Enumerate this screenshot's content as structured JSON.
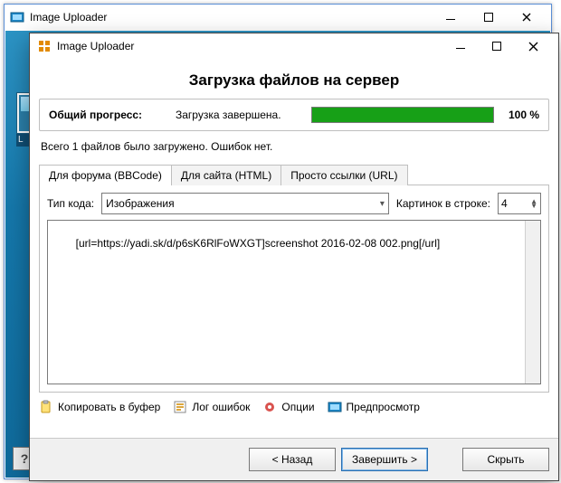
{
  "bgWindow": {
    "title": "Image Uploader",
    "thumbLetter": "L"
  },
  "dialog": {
    "title": "Image Uploader",
    "header": "Загрузка файлов на сервер",
    "progress": {
      "label": "Общий прогресс:",
      "status": "Загрузка завершена.",
      "percentText": "100 %"
    },
    "summary": "Всего 1 файлов было загружено. Ошибок нет.",
    "tabs": {
      "bbcode": "Для форума (BBCode)",
      "html": "Для сайта (HTML)",
      "url": "Просто ссылки (URL)"
    },
    "codeTypeLabel": "Тип кода:",
    "codeTypeSelected": "Изображения",
    "picsPerRowLabel": "Картинок в строке:",
    "picsPerRowValue": "4",
    "output": "[url=https://yadi.sk/d/p6sK6RlFoWXGT]screenshot 2016-02-08 002.png[/url]",
    "actions": {
      "copy": "Копировать в буфер",
      "log": "Лог ошибок",
      "options": "Опции",
      "preview": "Предпросмотр"
    },
    "buttons": {
      "back": "< Назад",
      "finish": "Завершить >",
      "hide": "Скрыть"
    }
  },
  "help": "?"
}
